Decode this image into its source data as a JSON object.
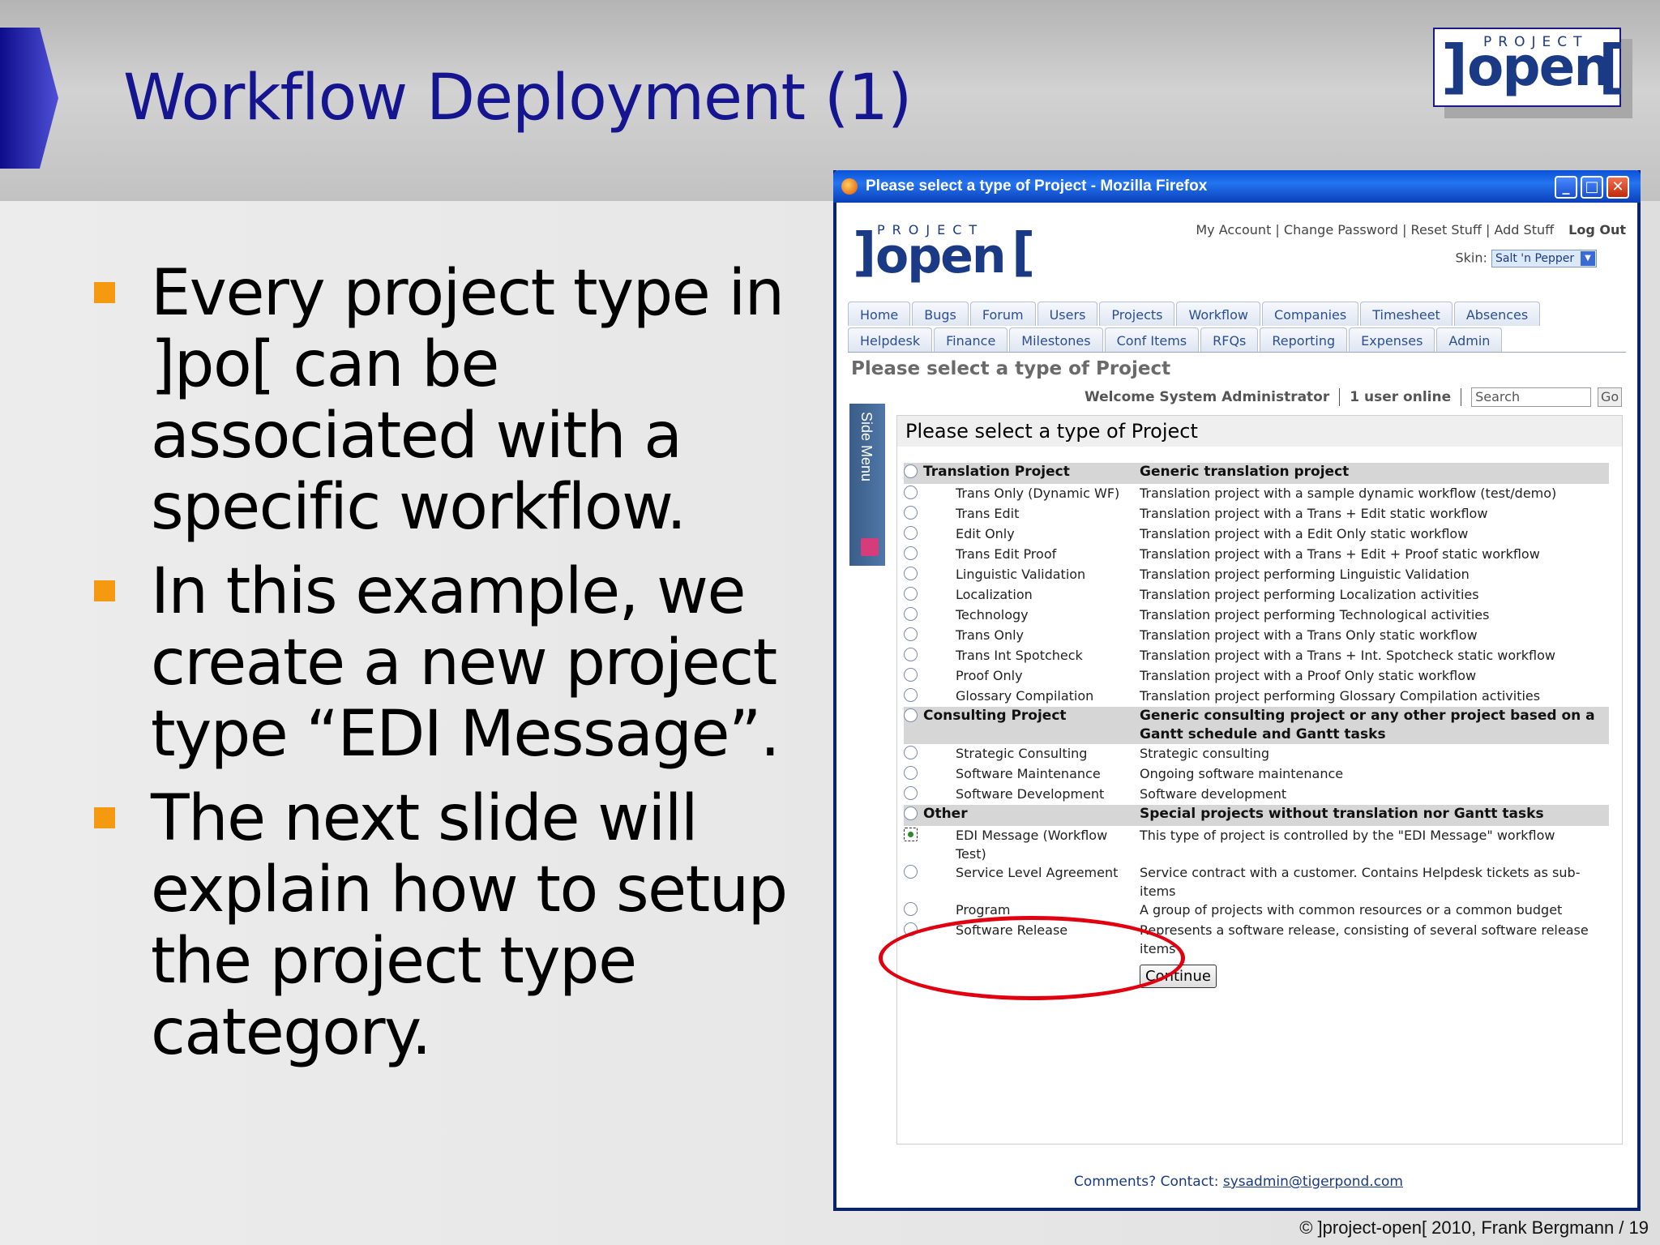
{
  "slide": {
    "title": "Workflow Deployment (1)",
    "logo": {
      "small": "PROJECT",
      "word": "open",
      "lb": "]",
      "rb": "["
    },
    "bullets": [
      "Every project type in ]po[ can be associated with a specific workflow.",
      "In this example, we create a new project type “EDI Message”.",
      "The next slide will explain how to setup the project type category."
    ],
    "footer": "©  ]project-open[ 2010, Frank Bergmann / 19"
  },
  "browser": {
    "title": "Please select a type of Project - Mozilla Firefox",
    "buttons": {
      "min": "_",
      "max": "□",
      "close": "✕"
    },
    "logo": {
      "small": "PROJECT",
      "word": "open",
      "lb": "]",
      "rb": "["
    },
    "top_links": "My Account | Change Password | Reset Stuff | Add Stuff",
    "logout": "Log Out",
    "skin_label": "Skin:",
    "skin_value": "Salt 'n Pepper",
    "tabs_row1": [
      "Home",
      "Bugs",
      "Forum",
      "Users",
      "Projects",
      "Workflow",
      "Companies",
      "Timesheet",
      "Absences"
    ],
    "tabs_row2": [
      "Helpdesk",
      "Finance",
      "Milestones",
      "Conf Items",
      "RFQs",
      "Reporting",
      "Expenses",
      "Admin"
    ],
    "page_title": "Please select a type of Project",
    "welcome": "Welcome System Administrator",
    "users_online": "1 user online",
    "search_placeholder": "Search",
    "go": "Go",
    "side_menu": "Side Menu",
    "panel_title": "Please select a type of Project",
    "rows": [
      {
        "header": true,
        "name": "Translation Project",
        "desc": "Generic translation project"
      },
      {
        "name": "Trans Only (Dynamic WF)",
        "desc": "Translation project with a sample dynamic workflow (test/demo)"
      },
      {
        "name": "Trans Edit",
        "desc": "Translation project with a Trans + Edit static workflow"
      },
      {
        "name": "Edit Only",
        "desc": "Translation project with a Edit Only static workflow"
      },
      {
        "name": "Trans Edit Proof",
        "desc": "Translation project with a Trans + Edit + Proof static workflow"
      },
      {
        "name": "Linguistic Validation",
        "desc": "Translation project performing Linguistic Validation"
      },
      {
        "name": "Localization",
        "desc": "Translation project performing Localization activities"
      },
      {
        "name": "Technology",
        "desc": "Translation project performing Technological activities"
      },
      {
        "name": "Trans Only",
        "desc": "Translation project with a Trans Only static workflow"
      },
      {
        "name": "Trans Int Spotcheck",
        "desc": "Translation project with a Trans + Int. Spotcheck static workflow"
      },
      {
        "name": "Proof Only",
        "desc": "Translation project with a Proof Only static workflow"
      },
      {
        "name": "Glossary Compilation",
        "desc": "Translation project performing Glossary Compilation activities"
      },
      {
        "header": true,
        "name": "Consulting Project",
        "desc": "Generic consulting project or any other project based on a Gantt schedule and Gantt tasks"
      },
      {
        "name": "Strategic Consulting",
        "desc": "Strategic consulting"
      },
      {
        "name": "Software Maintenance",
        "desc": "Ongoing software maintenance"
      },
      {
        "name": "Software Development",
        "desc": "Software development"
      },
      {
        "header": true,
        "name": "Other",
        "desc": "Special projects without translation nor Gantt tasks"
      },
      {
        "name": "EDI Message (Workflow Test)",
        "desc": "This type of project is controlled by the \"EDI Message\" workflow",
        "selected": true
      },
      {
        "name": "Service Level Agreement",
        "desc": "Service contract with a customer. Contains Helpdesk tickets as sub-items"
      },
      {
        "name": "Program",
        "desc": "A group of projects with common resources or a common budget"
      },
      {
        "name": "Software Release",
        "desc": "Represents a software release, consisting of several software release items"
      }
    ],
    "continue": "Continue",
    "comments_label": "Comments? Contact:",
    "comments_email": "sysadmin@tigerpond.com"
  },
  "colors": {
    "title": "#15158f",
    "bullet": "#f59a10",
    "highlight": "#e00010",
    "titlebar": "#0a52d8"
  }
}
